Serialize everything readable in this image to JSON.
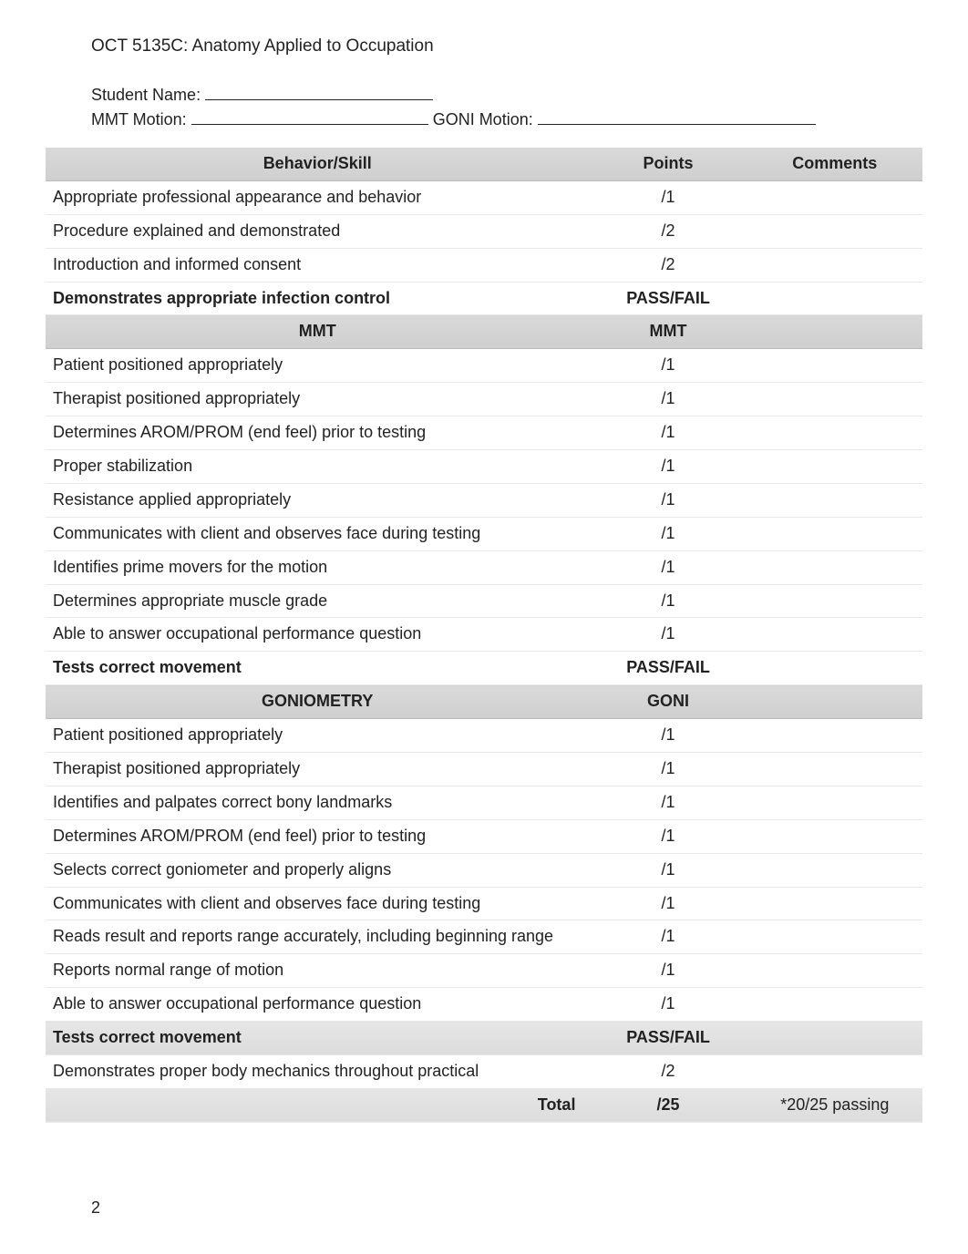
{
  "header": {
    "course_title": "OCT 5135C: Anatomy Applied to Occupation"
  },
  "form": {
    "student_name_label": "Student Name: ",
    "mmt_motion_label": "MMT Motion: ",
    "goni_motion_label": " GONI Motion: "
  },
  "columns": {
    "skill": "Behavior/Skill",
    "points": "Points",
    "comments": "Comments"
  },
  "sections": [
    {
      "type": "header",
      "skill": "Behavior/Skill",
      "points": "Points",
      "comments": "Comments"
    },
    {
      "type": "row",
      "skill": "Appropriate professional appearance and behavior",
      "points": "/1"
    },
    {
      "type": "row",
      "skill": "Procedure explained and demonstrated",
      "points": "/2"
    },
    {
      "type": "row",
      "skill": "Introduction and informed consent",
      "points": "/2"
    },
    {
      "type": "bold",
      "skill": "Demonstrates appropriate infection control",
      "points": "PASS/FAIL"
    },
    {
      "type": "header",
      "skill": "MMT",
      "points": "MMT",
      "comments": ""
    },
    {
      "type": "row",
      "skill": "Patient positioned appropriately",
      "points": "/1"
    },
    {
      "type": "row",
      "skill": "Therapist positioned appropriately",
      "points": "/1"
    },
    {
      "type": "row",
      "skill": "Determines AROM/PROM (end feel) prior to testing",
      "points": "/1"
    },
    {
      "type": "row",
      "skill": "Proper stabilization",
      "points": "/1"
    },
    {
      "type": "row",
      "skill": "Resistance applied appropriately",
      "points": "/1"
    },
    {
      "type": "row",
      "skill": "Communicates with client and observes face during testing",
      "points": "/1"
    },
    {
      "type": "row",
      "skill": "Identifies prime movers for the motion",
      "points": "/1"
    },
    {
      "type": "row",
      "skill": "Determines appropriate muscle grade",
      "points": "/1"
    },
    {
      "type": "row",
      "skill": "Able to answer occupational performance question",
      "points": "/1"
    },
    {
      "type": "bold",
      "skill": "Tests correct movement",
      "points": "PASS/FAIL"
    },
    {
      "type": "header",
      "skill": "GONIOMETRY",
      "points": "GONI",
      "comments": ""
    },
    {
      "type": "row",
      "skill": "Patient positioned appropriately",
      "points": "/1"
    },
    {
      "type": "row",
      "skill": "Therapist positioned appropriately",
      "points": "/1"
    },
    {
      "type": "row",
      "skill": "Identifies and palpates correct bony landmarks",
      "points": "/1"
    },
    {
      "type": "row",
      "skill": "Determines AROM/PROM (end feel) prior to testing",
      "points": "/1"
    },
    {
      "type": "row",
      "skill": "Selects correct goniometer and properly aligns",
      "points": "/1"
    },
    {
      "type": "row",
      "skill": "Communicates with client and observes face during testing",
      "points": "/1"
    },
    {
      "type": "row",
      "skill": "Reads result and reports range accurately, including beginning range",
      "points": "/1"
    },
    {
      "type": "row",
      "skill": "Reports normal range of motion",
      "points": "/1"
    },
    {
      "type": "row",
      "skill": "Able to answer occupational performance question",
      "points": "/1"
    },
    {
      "type": "shaded-bold",
      "skill": "Tests correct movement",
      "points": "PASS/FAIL"
    },
    {
      "type": "row",
      "skill": "Demonstrates proper body mechanics throughout practical",
      "points": "/2"
    },
    {
      "type": "total",
      "skill": "Total",
      "points": "/25",
      "comments": "*20/25 passing"
    }
  ],
  "page_number": "2"
}
